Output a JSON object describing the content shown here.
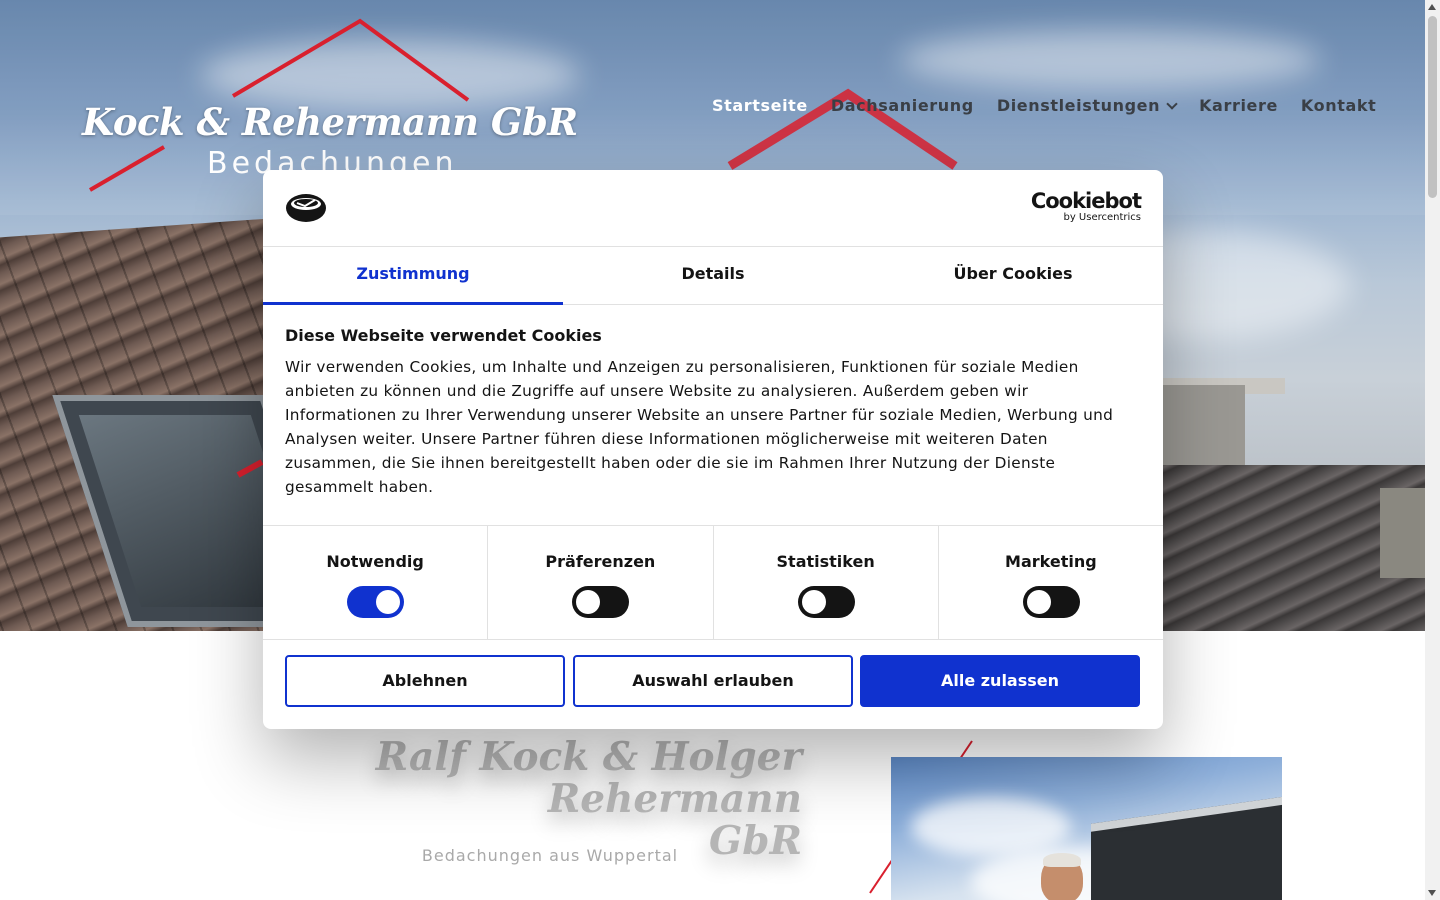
{
  "site": {
    "logo_title": "Kock & Rehermann GbR",
    "logo_subtitle": "Bedachungen",
    "nav": [
      {
        "label": "Startseite",
        "active": true
      },
      {
        "label": "Dachsanierung",
        "active": false
      },
      {
        "label": "Dienstleistungen",
        "active": false,
        "has_dropdown": true
      },
      {
        "label": "Karriere",
        "active": false
      },
      {
        "label": "Kontakt",
        "active": false
      }
    ],
    "accent_color": "#d9202e",
    "content_title_line1": "Ralf Kock & Holger Rehermann",
    "content_title_line2": "GbR",
    "content_subtitle": "Bedachungen aus Wuppertal"
  },
  "cookie_dialog": {
    "brand": "Cookiebot",
    "brand_sub": "by Usercentrics",
    "tabs": [
      {
        "label": "Zustimmung",
        "active": true
      },
      {
        "label": "Details",
        "active": false
      },
      {
        "label": "Über Cookies",
        "active": false
      }
    ],
    "heading": "Diese Webseite verwendet Cookies",
    "text": "Wir verwenden Cookies, um Inhalte und Anzeigen zu personalisieren, Funktionen für soziale Medien anbieten zu können und die Zugriffe auf unsere Website zu analysieren. Außerdem geben wir Informationen zu Ihrer Verwendung unserer Website an unsere Partner für soziale Medien, Werbung und Analysen weiter. Unsere Partner führen diese Informationen möglicherweise mit weiteren Daten zusammen, die Sie ihnen bereitgestellt haben oder die sie im Rahmen Ihrer Nutzung der Dienste gesammelt haben.",
    "toggles": [
      {
        "label": "Notwendig",
        "checked": true
      },
      {
        "label": "Präferenzen",
        "checked": false
      },
      {
        "label": "Statistiken",
        "checked": false
      },
      {
        "label": "Marketing",
        "checked": false
      }
    ],
    "buttons": {
      "decline": "Ablehnen",
      "allow_selection": "Auswahl erlauben",
      "allow_all": "Alle zulassen"
    },
    "primary_color": "#1032cf"
  }
}
